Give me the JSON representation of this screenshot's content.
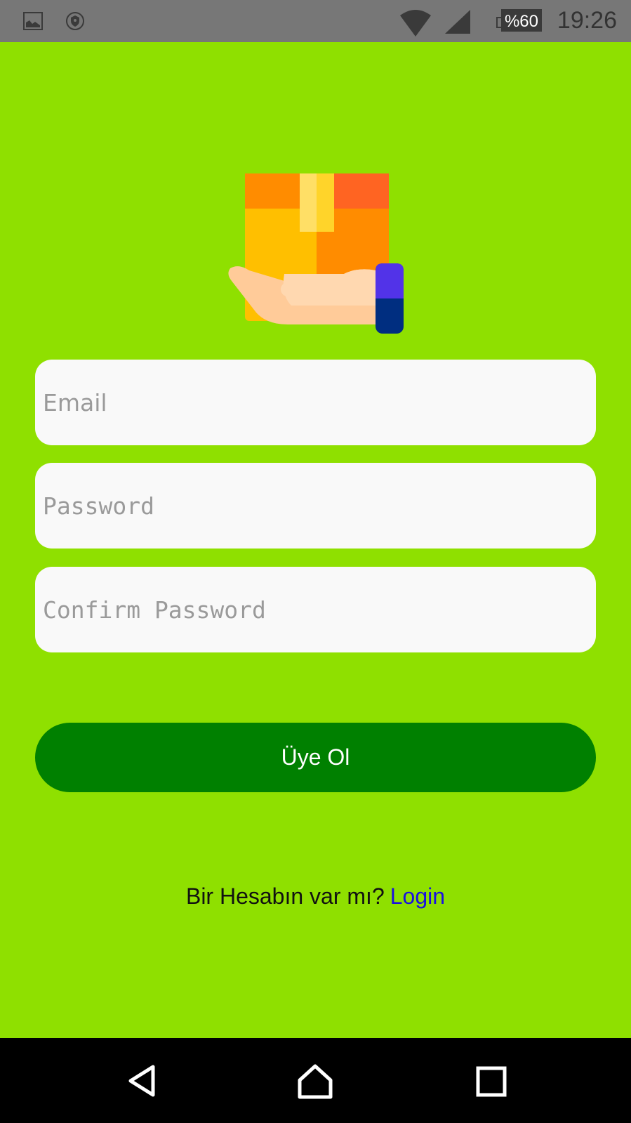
{
  "status_bar": {
    "battery": "%60",
    "time": "19:26",
    "icons": [
      "image-icon",
      "vpn-shield-icon",
      "wifi-icon",
      "signal-icon",
      "battery-icon"
    ]
  },
  "form": {
    "email_placeholder": "Email",
    "password_placeholder": "Password",
    "confirm_placeholder": "Confirm Password",
    "submit_label": "Üye Ol"
  },
  "footer": {
    "prompt": "Bir Hesabın var mı?",
    "link": "Login"
  },
  "colors": {
    "background": "#8fe000",
    "button": "#008000",
    "link": "#1a10e0"
  },
  "nav_bar": {
    "icons": [
      "back-icon",
      "home-icon",
      "recents-icon"
    ]
  }
}
